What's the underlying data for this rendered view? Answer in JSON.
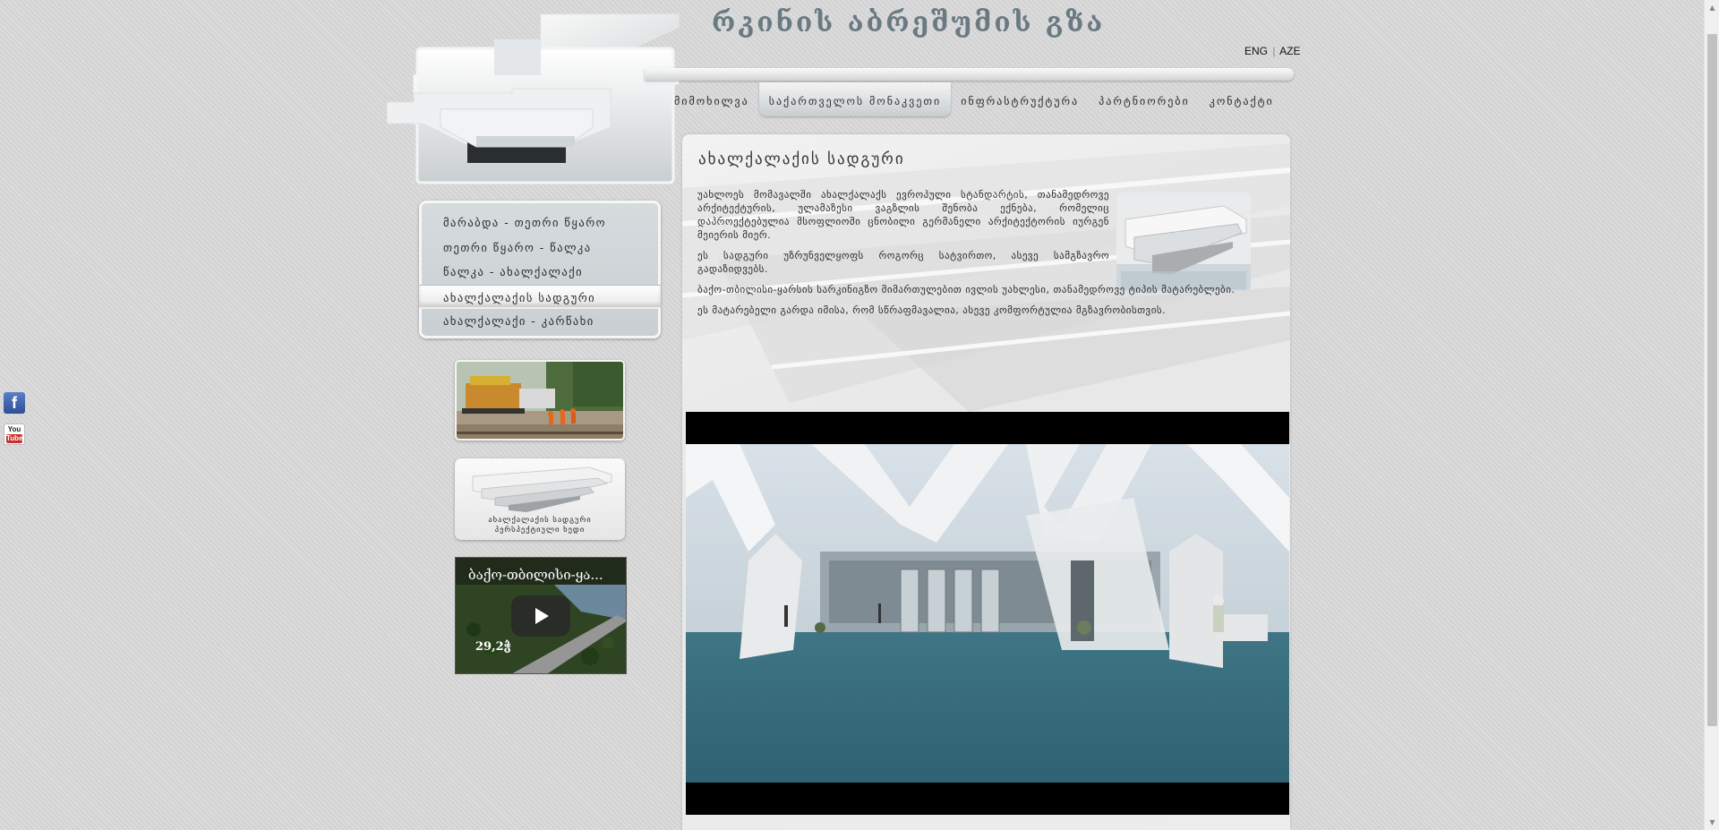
{
  "site": {
    "title": "რკინის აბრეშუმის გზა",
    "lang_eng": "ENG",
    "lang_sep": "|",
    "lang_aze": "AZE"
  },
  "nav": {
    "items": [
      {
        "label": "მიმოხილვა",
        "active": false
      },
      {
        "label": "საქართველოს მონაკვეთი",
        "active": true
      },
      {
        "label": "ინფრასტრუქტურა",
        "active": false
      },
      {
        "label": "პარტნიორები",
        "active": false
      },
      {
        "label": "კონტაქტი",
        "active": false
      }
    ]
  },
  "submenu": {
    "items": [
      {
        "label": "მარაბდა - თეთრი წყარო",
        "active": false
      },
      {
        "label": "თეთრი წყარო - წალკა",
        "active": false
      },
      {
        "label": "წალკა - ახალქალაქი",
        "active": false
      },
      {
        "label": "ახალქალაქის სადგური",
        "active": true
      },
      {
        "label": "ახალქალაქი - კარწახი",
        "active": false
      }
    ]
  },
  "widgets": {
    "station_caption_1": "ახალქალაქის სადგური",
    "station_caption_2": "პერსპექტიული ხედი",
    "video_title": "ბაქო-თბილისი-ყა...",
    "video_time": "29,2ჭ"
  },
  "content": {
    "title": "ახალქალაქის სადგური",
    "paragraphs": [
      "უახლოეს მომავალში ახალქალაქს ევროპული სტანდარტის, თანამედროვე არქიტექტურის, ულამაზესი ვაგზლის შენობა ექნება, რომელიც დაპროექტებულია მსოფლიოში ცნობილი გერმანელი არქიტექტორის იურგენ მეიერის მიერ.",
      "ეს სადგური უზრუნველყოფს როგორც სატვირთო, ასევე სამგზავრო გადაზიდვებს.",
      "ბაქო-თბილისი-ყარსის სარკინიგზო მიმართულებით ივლის უახლესი, თანამედროვე ტიპის მატარებლები.",
      "ეს მატარებელი გარდა იმისა, რომ სწრაფმავალია, ასევე კომფორტულია მგზავრობისთვის."
    ]
  },
  "social": {
    "facebook": "f",
    "youtube_you": "You",
    "youtube_tube": "Tube"
  }
}
